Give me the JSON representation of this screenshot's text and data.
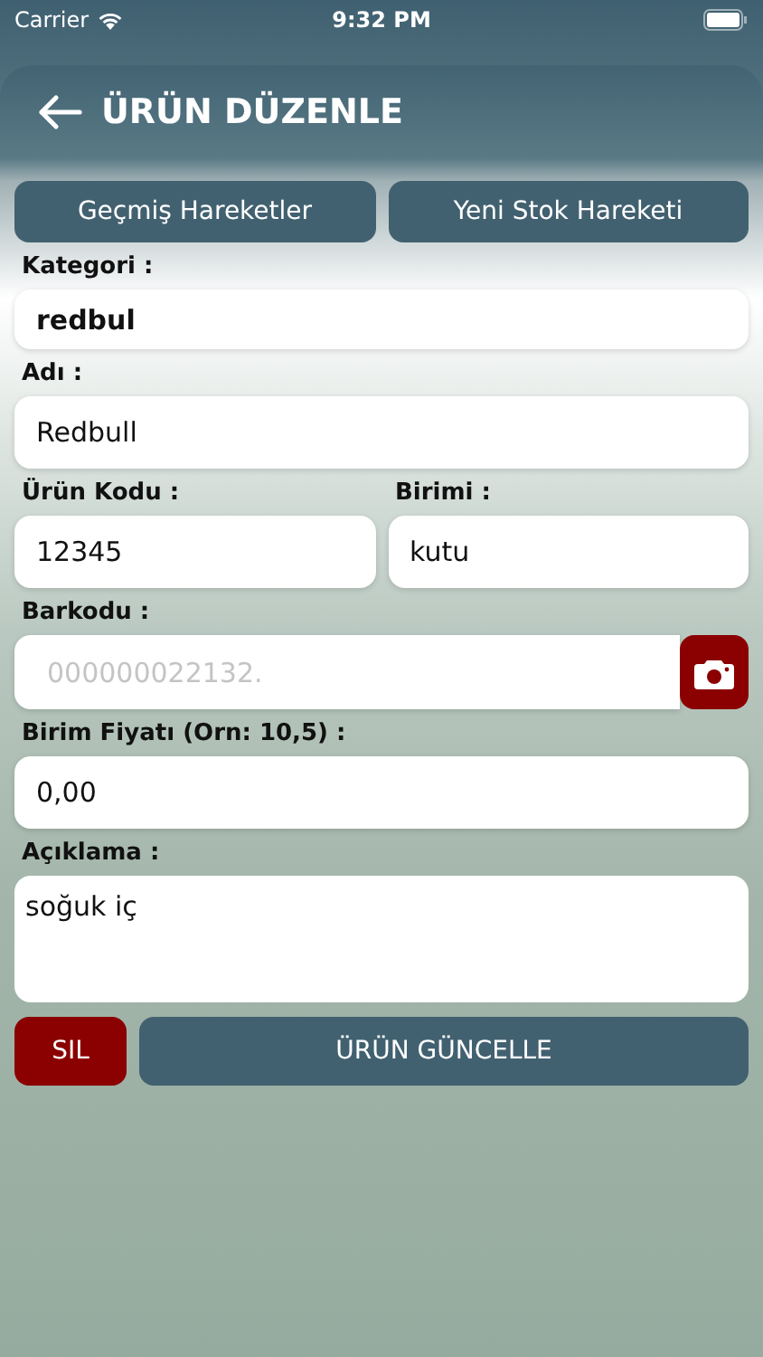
{
  "status_bar": {
    "carrier": "Carrier",
    "time": "9:32 PM"
  },
  "header": {
    "title": "ÜRÜN DÜZENLE"
  },
  "top_buttons": [
    "Geçmiş Hareketler",
    "Yeni Stok Hareketi"
  ],
  "category": {
    "label": "Kategori :",
    "value": "redbul"
  },
  "name": {
    "label": "Adı :",
    "value": "Redbull"
  },
  "code": {
    "label": "Ürün Kodu :",
    "value": "12345"
  },
  "unit": {
    "label": "Birimi :",
    "value": "kutu"
  },
  "barcode": {
    "label": "Barkodu :",
    "placeholder": "000000022132."
  },
  "price": {
    "label": "Birim Fiyatı (Orn: 10,5) :",
    "value": "0,00"
  },
  "description": {
    "label": "Açıklama :",
    "value": "soğuk iç"
  },
  "actions": {
    "delete": "SIL",
    "update": "ÜRÜN GÜNCELLE"
  }
}
